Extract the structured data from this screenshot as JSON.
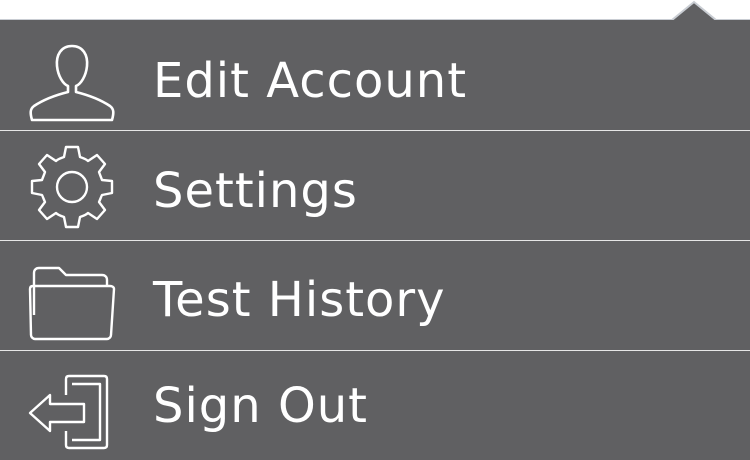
{
  "menu": {
    "items": [
      {
        "label": "Edit Account",
        "icon": "user-icon"
      },
      {
        "label": "Settings",
        "icon": "gear-icon"
      },
      {
        "label": "Test History",
        "icon": "folder-icon"
      },
      {
        "label": "Sign Out",
        "icon": "sign-out-icon"
      }
    ]
  },
  "colors": {
    "menu_background": "#606062",
    "divider": "#e6e6e6",
    "text": "#ffffff"
  }
}
